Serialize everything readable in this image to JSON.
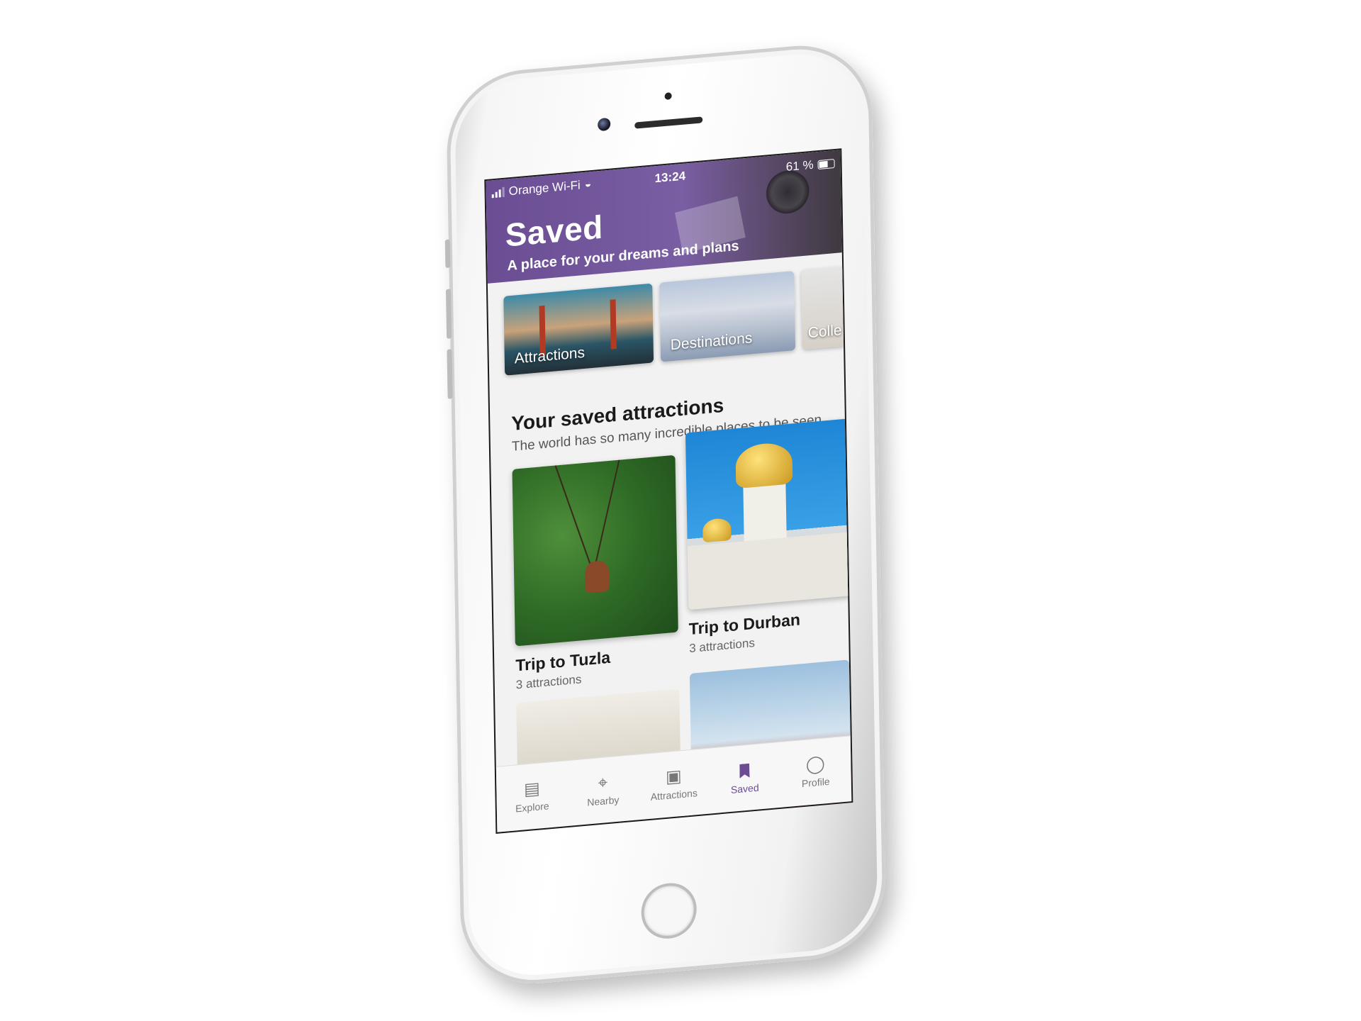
{
  "status_bar": {
    "carrier": "Orange Wi-Fi",
    "time": "13:24",
    "battery": "61 %"
  },
  "header": {
    "title": "Saved",
    "subtitle": "A place for your dreams and plans"
  },
  "categories": [
    {
      "label": "Attractions"
    },
    {
      "label": "Destinations"
    },
    {
      "label": "Colle"
    }
  ],
  "section": {
    "title": "Your saved attractions",
    "subtitle": "The world has so many incredible places to be seen"
  },
  "trips": [
    {
      "name": "Trip to Tuzla",
      "count": "3 attractions"
    },
    {
      "name": "Trip to Durban",
      "count": "3 attractions"
    }
  ],
  "tabs": [
    {
      "label": "Explore",
      "icon": "map-icon"
    },
    {
      "label": "Nearby",
      "icon": "location-pin-icon"
    },
    {
      "label": "Attractions",
      "icon": "camera-icon"
    },
    {
      "label": "Saved",
      "icon": "bookmark-icon",
      "active": true
    },
    {
      "label": "Profile",
      "icon": "person-icon"
    }
  ],
  "colors": {
    "accent": "#6a4d93",
    "header_bg": "#7a5ea3",
    "screen_bg": "#f2f2f2"
  }
}
